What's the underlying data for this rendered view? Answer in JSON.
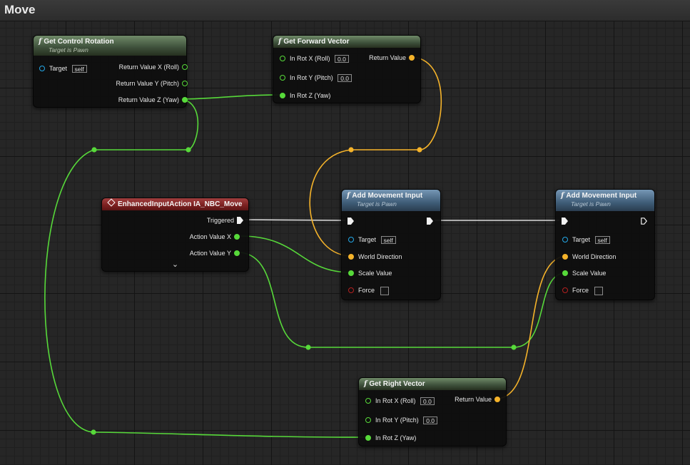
{
  "graph": {
    "title": "Move"
  },
  "nodes": {
    "get_control_rotation": {
      "title": "Get Control Rotation",
      "subtitle": "Target is Pawn",
      "target_label": "Target",
      "target_value": "self",
      "out_x": "Return Value X (Roll)",
      "out_y": "Return Value Y (Pitch)",
      "out_z": "Return Value Z (Yaw)"
    },
    "get_forward_vector": {
      "title": "Get Forward Vector",
      "in_x": "In Rot X (Roll)",
      "in_x_value": "0.0",
      "in_y": "In Rot Y (Pitch)",
      "in_y_value": "0.0",
      "in_z": "In Rot Z (Yaw)",
      "return": "Return Value"
    },
    "enhanced_input": {
      "title": "EnhancedInputAction IA_NBC_Move",
      "triggered": "Triggered",
      "action_x": "Action Value X",
      "action_y": "Action Value Y",
      "expand": "⌄"
    },
    "add_movement_1": {
      "title": "Add Movement Input",
      "subtitle": "Target is Pawn",
      "target_label": "Target",
      "target_value": "self",
      "world_direction": "World Direction",
      "scale_value": "Scale Value",
      "force": "Force"
    },
    "add_movement_2": {
      "title": "Add Movement Input",
      "subtitle": "Target is Pawn",
      "target_label": "Target",
      "target_value": "self",
      "world_direction": "World Direction",
      "scale_value": "Scale Value",
      "force": "Force"
    },
    "get_right_vector": {
      "title": "Get Right Vector",
      "in_x": "In Rot X (Roll)",
      "in_x_value": "0.0",
      "in_y": "In Rot Y (Pitch)",
      "in_y_value": "0.0",
      "in_z": "In Rot Z (Yaw)",
      "return": "Return Value"
    }
  },
  "colors": {
    "exec_wire": "#d8d8d8",
    "float_wire": "#57d93a",
    "vector_wire": "#f5b32a",
    "object_pin": "#23a8e8",
    "bool_pin": "#b42020",
    "pure_header": "#3d4f3a",
    "call_header": "#3f5d78",
    "event_header": "#7a1f1f"
  },
  "icons": {
    "function": "f",
    "event": "diamond-icon",
    "exec": "exec-pin-icon"
  }
}
